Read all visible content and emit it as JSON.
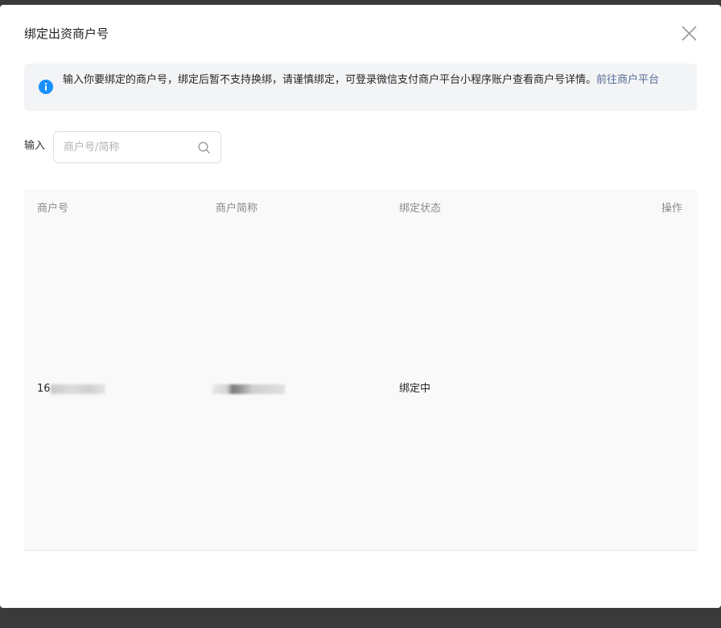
{
  "dialog": {
    "title": "绑定出资商户号",
    "close_icon": "close-icon"
  },
  "notice": {
    "icon": "info-icon",
    "text": "输入你要绑定的商户号，绑定后暂不支持换绑，请谨慎绑定，可登录微信支付商户平台小程序账户查看商户号详情。",
    "link": "前往商户平台",
    "colors": {
      "icon_bg": "#1890ff",
      "link": "#576b95"
    }
  },
  "search": {
    "label": "输入",
    "placeholder": "商户号/简称",
    "value": "",
    "icon": "search-icon"
  },
  "table": {
    "columns": [
      "商户号",
      "商户简称",
      "绑定状态",
      "操作"
    ],
    "rows": [
      {
        "merchant_id": "16",
        "short_name": "",
        "status": "绑定中",
        "action": ""
      }
    ]
  }
}
